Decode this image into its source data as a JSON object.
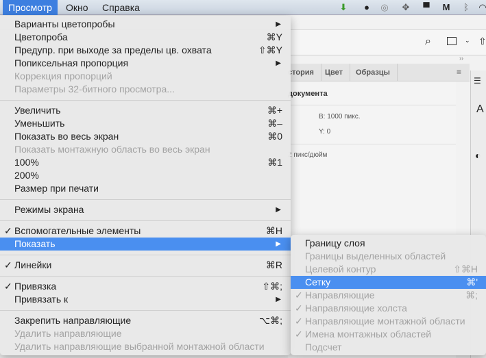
{
  "menubar": {
    "items": [
      "Просмотр",
      "Окно",
      "Справка"
    ],
    "active": 0,
    "accent": "#3d7fe0"
  },
  "tray_icons": [
    "download-icon",
    "evernote-icon",
    "creative-cloud-icon",
    "dropbox-icon",
    "airplay-icon",
    "malwarebytes-icon",
    "bluetooth-icon",
    "wifi-icon"
  ],
  "panel": {
    "tabs": [
      "стория",
      "Цвет",
      "Образцы"
    ],
    "section": "документа",
    "width": "В:  1000 пикс.",
    "y": "Y:  0",
    "resolution": "2 пикс/дюйм"
  },
  "menu": {
    "items": [
      {
        "label": "Варианты цветопробы",
        "submenu": true
      },
      {
        "label": "Цветопроба",
        "shortcut": "⌘Y"
      },
      {
        "label": "Предупр. при выходе за пределы цв. охвата",
        "shortcut": "⇧⌘Y"
      },
      {
        "label": "Попиксельная пропорция",
        "submenu": true
      },
      {
        "label": "Коррекция пропорций",
        "disabled": true
      },
      {
        "label": "Параметры 32-битного просмотра...",
        "disabled": true
      },
      {
        "sep": true
      },
      {
        "label": "Увеличить",
        "shortcut": "⌘+"
      },
      {
        "label": "Уменьшить",
        "shortcut": "⌘–"
      },
      {
        "label": "Показать во весь экран",
        "shortcut": "⌘0"
      },
      {
        "label": "Показать монтажную область во весь экран",
        "disabled": true
      },
      {
        "label": "100%",
        "shortcut": "⌘1"
      },
      {
        "label": "200%"
      },
      {
        "label": "Размер при печати"
      },
      {
        "sep": true
      },
      {
        "label": "Режимы экрана",
        "submenu": true
      },
      {
        "sep": true
      },
      {
        "label": "Вспомогательные элементы",
        "shortcut": "⌘H",
        "checked": true
      },
      {
        "label": "Показать",
        "submenu": true,
        "highlighted": true
      },
      {
        "sep": true
      },
      {
        "label": "Линейки",
        "shortcut": "⌘R",
        "checked": true
      },
      {
        "sep": true
      },
      {
        "label": "Привязка",
        "shortcut": "⇧⌘;",
        "checked": true
      },
      {
        "label": "Привязать к",
        "submenu": true
      },
      {
        "sep": true
      },
      {
        "label": "Закрепить направляющие",
        "shortcut": "⌥⌘;"
      },
      {
        "label": "Удалить направляющие",
        "disabled": true
      },
      {
        "label": "Удалить направляющие выбранной монтажной области",
        "disabled": true
      }
    ]
  },
  "submenu": {
    "items": [
      {
        "label": "Границу слоя"
      },
      {
        "label": "Границы выделенных областей",
        "disabled": true
      },
      {
        "label": "Целевой контур",
        "shortcut": "⇧⌘H",
        "disabled": true
      },
      {
        "label": "Сетку",
        "shortcut": "⌘'",
        "highlighted": true
      },
      {
        "label": "Направляющие",
        "shortcut": "⌘;",
        "disabled": true,
        "checked": true
      },
      {
        "label": "Направляющие холста",
        "disabled": true,
        "checked": true
      },
      {
        "label": "Направляющие монтажной области",
        "disabled": true,
        "checked": true
      },
      {
        "label": "Имена монтажных областей",
        "disabled": true,
        "checked": true
      },
      {
        "label": "Подсчет",
        "disabled": true
      }
    ]
  }
}
